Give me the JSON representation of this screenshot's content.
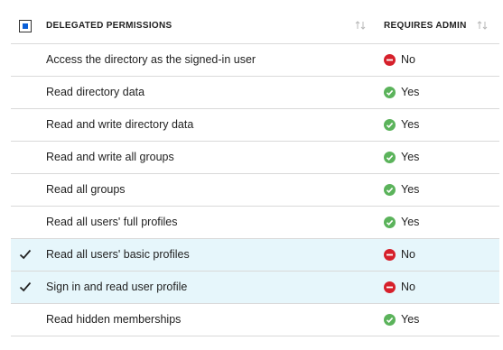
{
  "header": {
    "permissions_label": "DELEGATED PERMISSIONS",
    "admin_label": "REQUIRES ADMIN",
    "select_all_state": "indeterminate"
  },
  "colors": {
    "selected_row": "#e6f6fb",
    "yes_icon": "#5bb35b",
    "no_icon": "#d6202b",
    "checkbox_indeterminate": "#0a5fd8"
  },
  "rows": [
    {
      "permission": "Access the directory as the signed-in user",
      "admin": "No",
      "admin_icon": "minus-circle-icon",
      "checked": false
    },
    {
      "permission": "Read directory data",
      "admin": "Yes",
      "admin_icon": "check-circle-icon",
      "checked": false
    },
    {
      "permission": "Read and write directory data",
      "admin": "Yes",
      "admin_icon": "check-circle-icon",
      "checked": false
    },
    {
      "permission": "Read and write all groups",
      "admin": "Yes",
      "admin_icon": "check-circle-icon",
      "checked": false
    },
    {
      "permission": "Read all groups",
      "admin": "Yes",
      "admin_icon": "check-circle-icon",
      "checked": false
    },
    {
      "permission": "Read all users' full profiles",
      "admin": "Yes",
      "admin_icon": "check-circle-icon",
      "checked": false
    },
    {
      "permission": "Read all users' basic profiles",
      "admin": "No",
      "admin_icon": "minus-circle-icon",
      "checked": true
    },
    {
      "permission": "Sign in and read user profile",
      "admin": "No",
      "admin_icon": "minus-circle-icon",
      "checked": true
    },
    {
      "permission": "Read hidden memberships",
      "admin": "Yes",
      "admin_icon": "check-circle-icon",
      "checked": false
    }
  ]
}
